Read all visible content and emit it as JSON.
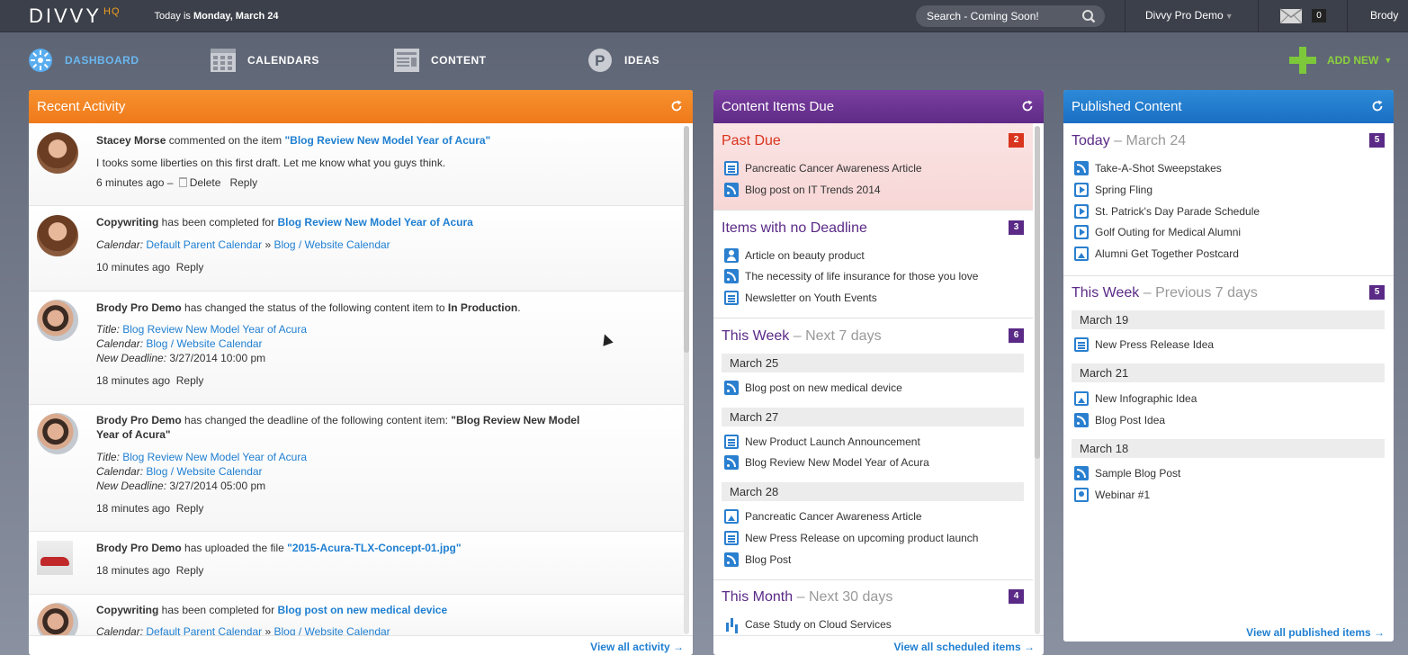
{
  "topbar": {
    "logo": "DIVVY",
    "logo_suffix": "HQ",
    "today_prefix": "Today is",
    "today_date": "Monday, March 24",
    "search_placeholder": "Search - Coming Soon!",
    "account": "Divvy Pro Demo",
    "mail_count": "0",
    "user": "Brody"
  },
  "nav": {
    "dashboard": "DASHBOARD",
    "calendars": "CALENDARS",
    "content": "CONTENT",
    "ideas": "IDEAS",
    "add_new": "ADD NEW"
  },
  "colors": {
    "activity_header": "#f38524",
    "due_header": "#6b3394",
    "published_header": "#2280d0",
    "link": "#1f7fd1",
    "add_new": "#7dc83a"
  },
  "activity": {
    "title": "Recent Activity",
    "view_all": "View all activity →",
    "items": [
      {
        "actor": "Stacey Morse",
        "verb": "commented on the item",
        "object": "\"Blog Review New Model Year of Acura\"",
        "comment": "I tooks some liberties on this first draft. Let me know what you guys think.",
        "time": "6 minutes ago –",
        "delete": "Delete",
        "reply": "Reply"
      },
      {
        "actor": "Copywriting",
        "verb": "has been completed for",
        "object": "Blog Review New Model Year of Acura",
        "calendar_label": "Calendar:",
        "calendar_a": "Default Parent Calendar",
        "calendar_sep": "»",
        "calendar_b": "Blog / Website Calendar",
        "time": "10 minutes ago",
        "reply": "Reply"
      },
      {
        "actor": "Brody Pro Demo",
        "verb": "has changed the status of the following content item to",
        "status": "In Production",
        "title_label": "Title:",
        "title": "Blog Review New Model Year of Acura",
        "calendar_label": "Calendar:",
        "calendar": "Blog / Website Calendar",
        "deadline_label": "New Deadline:",
        "deadline": "3/27/2014 10:00 pm",
        "time": "18 minutes ago",
        "reply": "Reply"
      },
      {
        "actor": "Brody Pro Demo",
        "verb": "has changed the deadline of the following content item:",
        "object_line1": "\"Blog Review New Model",
        "object_line2": "Year of Acura\"",
        "title_label": "Title:",
        "title": "Blog Review New Model Year of Acura",
        "calendar_label": "Calendar:",
        "calendar": "Blog / Website Calendar",
        "deadline_label": "New Deadline:",
        "deadline": "3/27/2014 05:00 pm",
        "time": "18 minutes ago",
        "reply": "Reply"
      },
      {
        "actor": "Brody Pro Demo",
        "verb": "has uploaded the file",
        "object": "\"2015-Acura-TLX-Concept-01.jpg\"",
        "time": "18 minutes ago",
        "reply": "Reply"
      },
      {
        "actor": "Copywriting",
        "verb": "has been completed for",
        "object": "Blog post on new medical device",
        "calendar_label": "Calendar:",
        "calendar_a": "Default Parent Calendar",
        "calendar_sep": "»",
        "calendar_b": "Blog / Website Calendar"
      }
    ]
  },
  "due": {
    "title": "Content Items Due",
    "view_all": "View all scheduled items →",
    "past_due": {
      "title": "Past Due",
      "count": "2",
      "items": [
        "Pancreatic Cancer Awareness Article",
        "Blog post on IT Trends 2014"
      ]
    },
    "no_deadline": {
      "title": "Items with no Deadline",
      "count": "3",
      "items": [
        "Article on beauty product",
        "The necessity of life insurance for those you love",
        "Newsletter on Youth Events"
      ]
    },
    "this_week": {
      "title": "This Week",
      "sub": "– Next 7 days",
      "count": "6",
      "d1": "March 25",
      "d1_items": [
        "Blog post on new medical device"
      ],
      "d2": "March 27",
      "d2_items": [
        "New Product Launch Announcement",
        "Blog Review New Model Year of Acura"
      ],
      "d3": "March 28",
      "d3_items": [
        "Pancreatic Cancer Awareness Article",
        "New Press Release on upcoming product launch",
        "Blog Post"
      ]
    },
    "this_month": {
      "title": "This Month",
      "sub": "– Next 30 days",
      "count": "4",
      "items": [
        "Case Study on Cloud Services"
      ]
    }
  },
  "published": {
    "title": "Published Content",
    "view_all": "View all published items →",
    "today": {
      "title": "Today",
      "sub": "– March 24",
      "count": "5",
      "items": [
        "Take-A-Shot Sweepstakes",
        "Spring Fling",
        "St. Patrick's Day Parade Schedule",
        "Golf Outing for Medical Alumni",
        "Alumni Get Together Postcard"
      ]
    },
    "this_week": {
      "title": "This Week",
      "sub": "– Previous 7 days",
      "count": "5",
      "d1": "March 19",
      "d1_items": [
        "New Press Release Idea"
      ],
      "d2": "March 21",
      "d2_items": [
        "New Infographic Idea",
        "Blog Post Idea"
      ],
      "d3": "March 18",
      "d3_items": [
        "Sample Blog Post",
        "Webinar #1"
      ]
    }
  }
}
